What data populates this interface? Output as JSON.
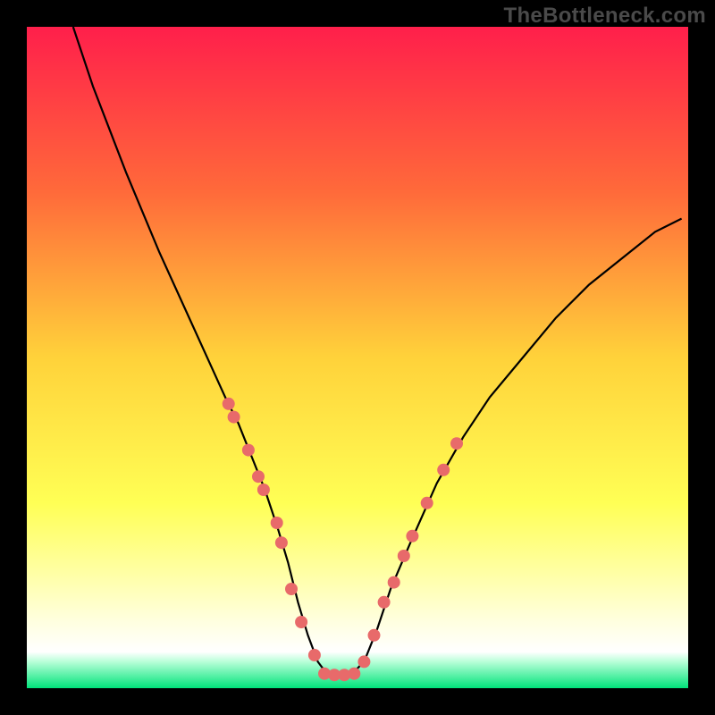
{
  "watermark": "TheBottleneck.com",
  "chart_data": {
    "type": "line",
    "title": "",
    "xlabel": "",
    "ylabel": "",
    "xlim": [
      0,
      100
    ],
    "ylim": [
      0,
      100
    ],
    "grid": false,
    "legend": false,
    "background": {
      "type": "vertical-gradient",
      "stops": [
        {
          "pos": 0.0,
          "color": "#ff1f4b"
        },
        {
          "pos": 0.25,
          "color": "#ff6a3a"
        },
        {
          "pos": 0.5,
          "color": "#ffd23a"
        },
        {
          "pos": 0.72,
          "color": "#ffff55"
        },
        {
          "pos": 0.82,
          "color": "#ffffa0"
        },
        {
          "pos": 0.9,
          "color": "#ffffe0"
        },
        {
          "pos": 0.945,
          "color": "#ffffff"
        },
        {
          "pos": 0.96,
          "color": "#b8ffd8"
        },
        {
          "pos": 1.0,
          "color": "#00e37a"
        }
      ]
    },
    "series": [
      {
        "name": "bottleneck-curve",
        "x": [
          7,
          10,
          15,
          20,
          25,
          30,
          32,
          34,
          36,
          38,
          39.5,
          41,
          42.5,
          44,
          45.5,
          47,
          49,
          51,
          53,
          55,
          58,
          62,
          66,
          70,
          75,
          80,
          85,
          90,
          95,
          99
        ],
        "y": [
          100,
          91,
          78,
          66,
          55,
          44,
          40,
          35,
          30,
          24,
          19,
          13,
          8,
          4,
          2,
          2,
          2,
          4,
          9,
          15,
          22,
          31,
          38,
          44,
          50,
          56,
          61,
          65,
          69,
          71
        ]
      }
    ],
    "markers": [
      {
        "x": 30.5,
        "y": 43
      },
      {
        "x": 31.3,
        "y": 41
      },
      {
        "x": 33.5,
        "y": 36
      },
      {
        "x": 35.0,
        "y": 32
      },
      {
        "x": 35.8,
        "y": 30
      },
      {
        "x": 37.8,
        "y": 25
      },
      {
        "x": 38.5,
        "y": 22
      },
      {
        "x": 40.0,
        "y": 15
      },
      {
        "x": 41.5,
        "y": 10
      },
      {
        "x": 43.5,
        "y": 5
      },
      {
        "x": 45.0,
        "y": 2.2
      },
      {
        "x": 46.5,
        "y": 2.0
      },
      {
        "x": 48.0,
        "y": 2.0
      },
      {
        "x": 49.5,
        "y": 2.2
      },
      {
        "x": 51.0,
        "y": 4
      },
      {
        "x": 52.5,
        "y": 8
      },
      {
        "x": 54.0,
        "y": 13
      },
      {
        "x": 55.5,
        "y": 16
      },
      {
        "x": 57.0,
        "y": 20
      },
      {
        "x": 58.3,
        "y": 23
      },
      {
        "x": 60.5,
        "y": 28
      },
      {
        "x": 63.0,
        "y": 33
      },
      {
        "x": 65.0,
        "y": 37
      }
    ],
    "marker_style": {
      "r": 7,
      "color": "#e86a6a"
    }
  }
}
